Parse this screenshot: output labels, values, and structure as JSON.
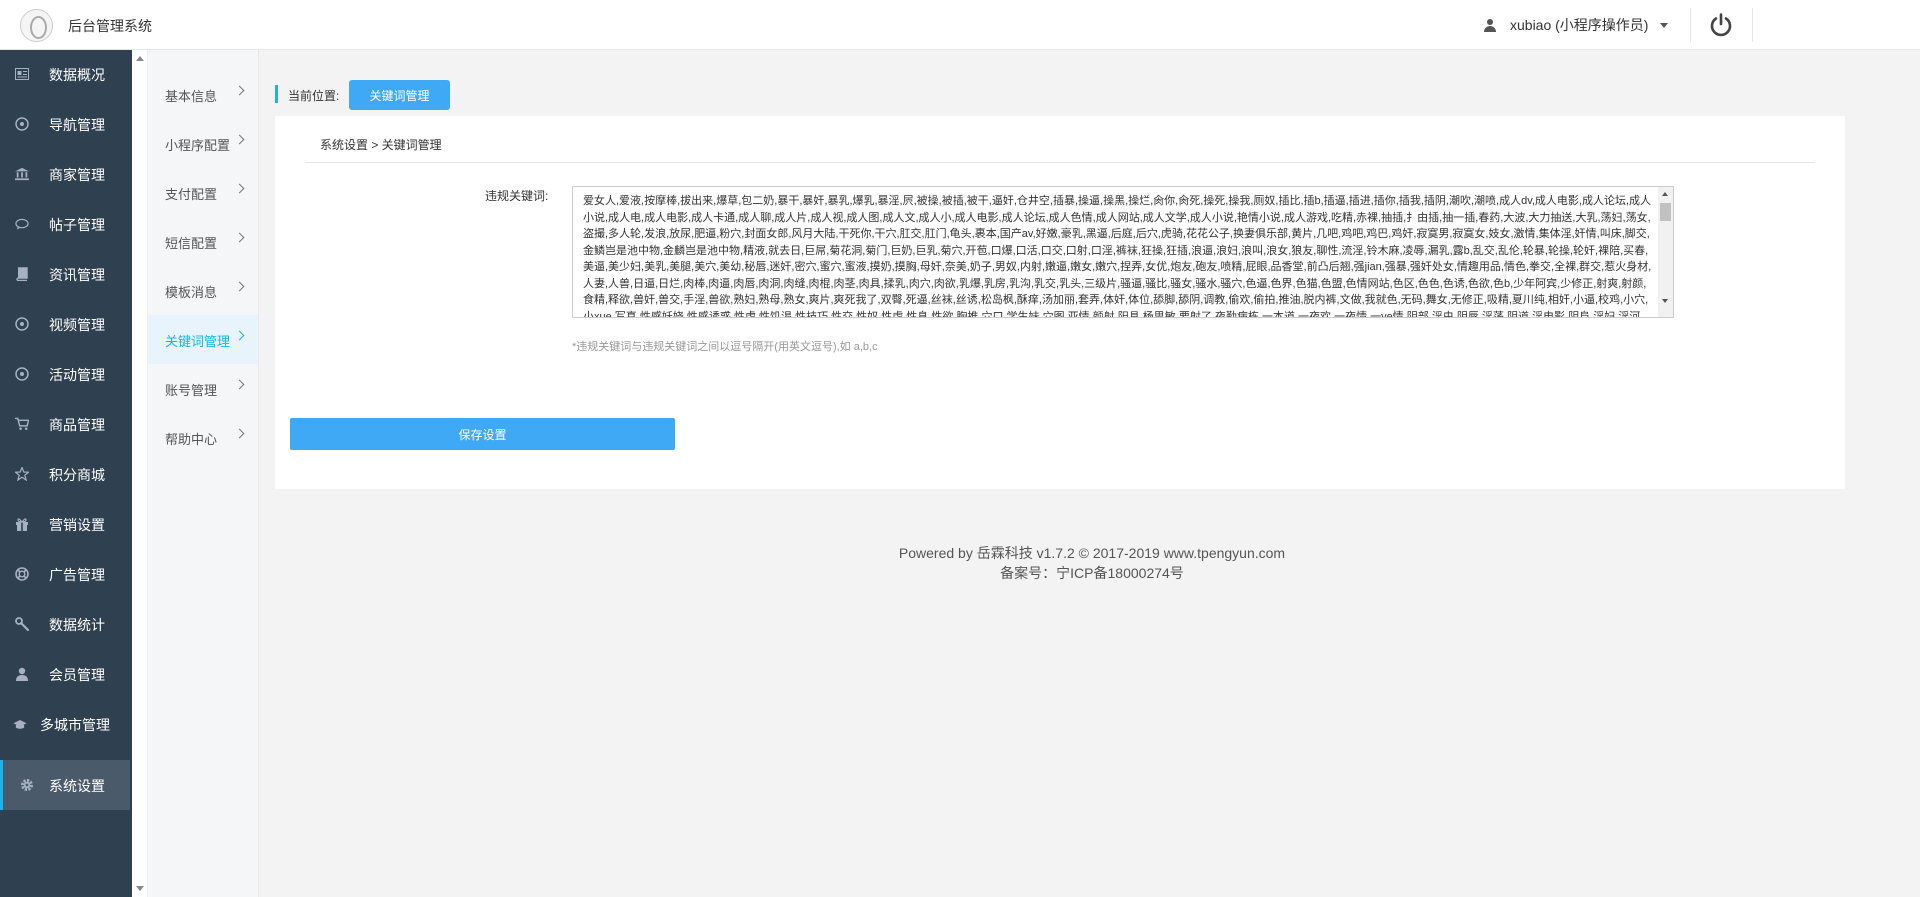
{
  "header": {
    "app_title": "后台管理系统",
    "user_label": "xubiao (小程序操作员)"
  },
  "sidebar": {
    "items": [
      {
        "label": "数据概况",
        "icon": "dashboard-icon"
      },
      {
        "label": "导航管理",
        "icon": "compass-icon"
      },
      {
        "label": "商家管理",
        "icon": "bank-icon"
      },
      {
        "label": "帖子管理",
        "icon": "comment-icon"
      },
      {
        "label": "资讯管理",
        "icon": "book-icon"
      },
      {
        "label": "视频管理",
        "icon": "video-icon"
      },
      {
        "label": "活动管理",
        "icon": "compass-icon"
      },
      {
        "label": "商品管理",
        "icon": "cart-icon"
      },
      {
        "label": "积分商城",
        "icon": "star-icon"
      },
      {
        "label": "营销设置",
        "icon": "gift-icon"
      },
      {
        "label": "广告管理",
        "icon": "lifebuoy-icon"
      },
      {
        "label": "数据统计",
        "icon": "wrench-icon"
      },
      {
        "label": "会员管理",
        "icon": "user-icon"
      },
      {
        "label": "多城市管理",
        "icon": "graduation-icon"
      },
      {
        "label": "系统设置",
        "icon": "gear-icon"
      }
    ],
    "active_index": 14
  },
  "subnav": {
    "items": [
      {
        "label": "基本信息"
      },
      {
        "label": "小程序配置"
      },
      {
        "label": "支付配置"
      },
      {
        "label": "短信配置"
      },
      {
        "label": "模板消息"
      },
      {
        "label": "关键词管理"
      },
      {
        "label": "账号管理"
      },
      {
        "label": "帮助中心"
      }
    ],
    "active_index": 5
  },
  "location": {
    "label": "当前位置:",
    "current": "关键词管理"
  },
  "panel": {
    "breadcrumb": "系统设置 > 关键词管理",
    "field_label": "违规关键词:",
    "keywords": "爱女人,爱液,按摩棒,拔出来,爆草,包二奶,暴干,暴奸,暴乳,爆乳,暴淫,屄,被操,被插,被干,逼奸,仓井空,插暴,操逼,操黑,操烂,肏你,肏死,操死,操我,厕奴,插比,插b,插逼,插进,插你,插我,插阴,潮吹,潮喷,成人dv,成人电影,成人论坛,成人小说,成人电,成人电影,成人卡通,成人聊,成人片,成人视,成人图,成人文,成人小,成人电影,成人论坛,成人色情,成人网站,成人文学,成人小说,艳情小说,成人游戏,吃精,赤裸,抽插,扌由插,抽一插,春药,大波,大力抽送,大乳,荡妇,荡女,盗撮,多人轮,发浪,放尿,肥逼,粉穴,封面女郎,风月大陆,干死你,干穴,肛交,肛门,龟头,裹本,国产av,好嫩,豪乳,黑逼,后庭,后穴,虎骑,花花公子,换妻俱乐部,黄片,几吧,鸡吧,鸡巴,鸡奸,寂寞男,寂寞女,妓女,激情,集体淫,奸情,叫床,脚交,金鳞岂是池中物,金麟岂是池中物,精液,就去日,巨屌,菊花洞,菊门,巨奶,巨乳,菊穴,开苞,口爆,口活,口交,口射,口淫,裤袜,狂操,狂插,浪逼,浪妇,浪叫,浪女,狼友,聊性,流淫,铃木麻,凌辱,漏乳,露b,乱交,乱伦,轮暴,轮操,轮奸,裸陪,买春,美逼,美少妇,美乳,美腿,美穴,美幼,秘唇,迷奸,密穴,蜜穴,蜜液,摸奶,摸胸,母奸,奈美,奶子,男奴,内射,嫩逼,嫩女,嫩穴,捏弄,女优,炮友,砲友,喷精,屁眼,品香堂,前凸后翘,强jian,强暴,强奸处女,情趣用品,情色,拳交,全裸,群交,惹火身材,人妻,人兽,日逼,日烂,肉棒,肉逼,肉唇,肉洞,肉缝,肉棍,肉茎,肉具,揉乳,肉穴,肉欲,乳爆,乳房,乳沟,乳交,乳头,三级片,骚逼,骚比,骚女,骚水,骚穴,色逼,色界,色猫,色盟,色情网站,色区,色色,色诱,色欲,色b,少年阿宾,少修正,射爽,射颜,食精,释欲,兽奸,兽交,手淫,兽欲,熟妇,熟母,熟女,爽片,爽死我了,双臀,死逼,丝袜,丝诱,松岛枫,酥痒,汤加丽,套弄,体奸,体位,舔脚,舔阴,调教,偷欢,偷拍,推油,脱内裤,文做,我就色,无码,舞女,无修正,吸精,夏川纯,相奸,小逼,校鸡,小穴,小xue,写真,性感妖娆,性感诱惑,性虎,性饥渴,性技巧,性交,性奴,性虐,性息,性欲,胸推,穴口,学生妹,穴图,亚情,颜射,阳具,杨思敏,要射了,夜勤病栋,一本道,一夜欢,一夜情,一ye情,阴部,淫虫,阴唇,淫荡,阴道,淫电影,阴阜,淫妇,淫河,阴核,阴户,淫贱,淫叫,淫教师,阴茎,阴精,淫浪,淫媚,淫糜,淫魔,淫母,淫女,淫虐,淫妻,淫情,淫色,淫声浪语,淫兽学园,淫书,淫术炼金士,淫水,淫娃,淫威,淫亵,淫样,淫液,淫照,阴b,应召,幼交,幼男,幼女,欲火,欲女,玉女心经,玉蒲团,玉乳,欲仙欲死,玉穴,援交,原味内衣,援助交际,张筱雨,招鸡,招妓,中年美妇,抓胸,自拍,自慰,作爱",
    "hint": "*违规关键词与违规关键词之间以逗号隔开(用英文逗号),如 a,b,c",
    "save_label": "保存设置"
  },
  "footer": {
    "powered": "Powered by 岳霖科技 v1.7.2 © 2017-2019 www.tpengyun.com",
    "icp": "备案号：宁ICP备18000274号"
  },
  "colors": {
    "sidebar_bg": "#2f4050",
    "accent": "#3fa9f5",
    "active_text": "#1ab3e8"
  }
}
